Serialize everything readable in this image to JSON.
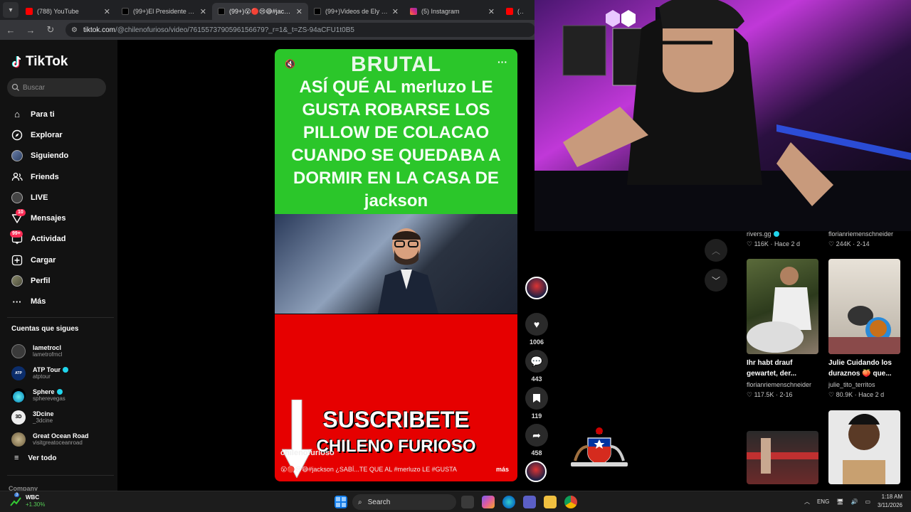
{
  "browser": {
    "tabs": [
      {
        "title": "(788) YouTube",
        "favicon": "youtube",
        "active": false
      },
      {
        "title": "(99+)El Presidente Gabriel",
        "favicon": "tiktok",
        "active": false
      },
      {
        "title": "(99+)😮🔴😢😅#jackso",
        "favicon": "tiktok",
        "active": true
      },
      {
        "title": "(99+)Videos de Ely Powur",
        "favicon": "tiktok",
        "active": false
      },
      {
        "title": "(5) Instagram",
        "favicon": "instagram",
        "active": false
      },
      {
        "title": "(78",
        "favicon": "youtube",
        "active": false
      }
    ],
    "url_host": "tiktok.com",
    "url_path": "/@chilenofurioso/video/7615573790596156679?_r=1&_t=ZS-94aCFU1t0B5"
  },
  "sidebar": {
    "logo": "TikTok",
    "search_placeholder": "Buscar",
    "nav": [
      {
        "label": "Para ti",
        "icon": "home-icon"
      },
      {
        "label": "Explorar",
        "icon": "compass-icon"
      },
      {
        "label": "Siguiendo",
        "icon": "following-avatar-icon"
      },
      {
        "label": "Friends",
        "icon": "friends-icon"
      },
      {
        "label": "LIVE",
        "icon": "live-icon"
      },
      {
        "label": "Mensajes",
        "icon": "messages-icon",
        "badge": "10"
      },
      {
        "label": "Actividad",
        "icon": "activity-icon",
        "badge": "99+"
      },
      {
        "label": "Cargar",
        "icon": "upload-icon"
      },
      {
        "label": "Perfil",
        "icon": "profile-icon"
      },
      {
        "label": "Más",
        "icon": "more-icon"
      }
    ],
    "following_title": "Cuentas que sigues",
    "following": [
      {
        "name": "lametrocl",
        "handle": "lametrofmcl",
        "verified": false,
        "color": "#3a3a3a"
      },
      {
        "name": "ATP Tour",
        "handle": "atptour",
        "verified": true,
        "color": "#0b2d6b"
      },
      {
        "name": "Sphere",
        "handle": "spherevegas",
        "verified": true,
        "color": "#1fa0c8"
      },
      {
        "name": "3Dcine",
        "handle": "_3dcine",
        "verified": false,
        "color": "#eeeeee"
      },
      {
        "name": "Great Ocean Road",
        "handle": "visitgreatoceanroad",
        "verified": false,
        "color": "#8a7a5a"
      }
    ],
    "see_all": "Ver todo",
    "company": "Company"
  },
  "video": {
    "headline": "BRUTAL",
    "caption": "ASÍ QUÉ AL merluzo LE GUSTA ROBARSE LOS PILLOW DE COLACAO CUANDO SE QUEDABA A DORMIR EN LA CASA DE jackson",
    "subscribe": "SUSCRIBETE",
    "channel_banner": "CHILENO FURIOSO",
    "author": "chilenofurioso",
    "description": "😮🔴😢😅#jackson ¿SABÍ...TE QUE AL #merluzo LE #GUSTA",
    "more": "más"
  },
  "actions": {
    "likes": "1006",
    "comments": "443",
    "saves": "119",
    "shares": "458"
  },
  "recommended": [
    {
      "user": "rivers.gg",
      "verified": true,
      "likes": "116K",
      "date": "Hace 2 d"
    },
    {
      "user": "florianriemenschneider",
      "verified": false,
      "likes": "244K",
      "date": "2-14"
    },
    {
      "title": "Ihr habt drauf gewartet, der...",
      "user": "florianriemenschneider",
      "verified": false,
      "likes": "117.5K",
      "date": "2-16"
    },
    {
      "title": "Julie Cuidando los duraznos 🍑 que...",
      "user": "julie_tito_territos",
      "verified": false,
      "likes": "80.9K",
      "date": "Hace 2 d"
    }
  ],
  "taskbar": {
    "stock_name": "WBC",
    "stock_change": "+1.30%",
    "stock_badge": "3",
    "search": "Search",
    "lang": "ENG",
    "time": "1:18 AM",
    "date": "3/11/2026"
  }
}
